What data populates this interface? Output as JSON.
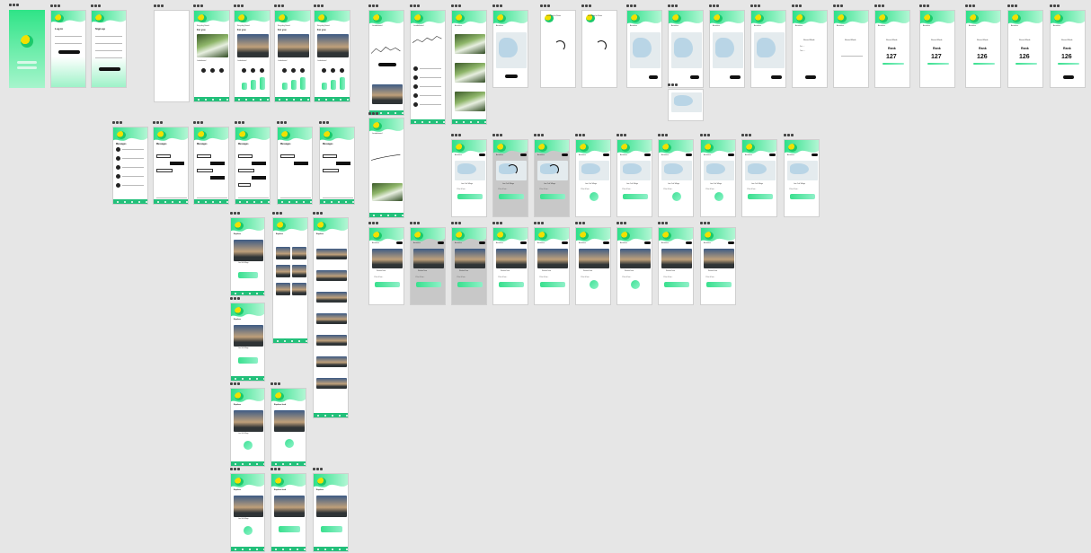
{
  "canvas": {
    "background": "#e6e6e6",
    "accent": "#2ee08a",
    "accent_light": "#9ef2c8",
    "dark": "#111111"
  },
  "icons": {
    "frame_menu": "three-dots-icon",
    "logo": "leaf-logo-icon",
    "nav": [
      "home-icon",
      "map-icon",
      "add-icon",
      "leaf-icon",
      "profile-icon"
    ]
  },
  "text": {
    "login": "Log in",
    "sign_up": "Sign up",
    "login_btn": "Login",
    "signup_btn": "Sign up",
    "recycling": "Recycling Round",
    "for_you": "For you",
    "leaderboard": "Leaderboard",
    "messages": "Messages",
    "activities": "Activities",
    "searching": "Searching for Route",
    "round_made": "Round Made",
    "rank": "Rank",
    "ranks": [
      "127",
      "127",
      "126",
      "126",
      "126"
    ],
    "workout_done": "Workout Done",
    "explore": "Explore",
    "my_feed": "Explore feed",
    "start": "Start",
    "village": "Live Oak Village",
    "mo_rank": "Mo"
  }
}
